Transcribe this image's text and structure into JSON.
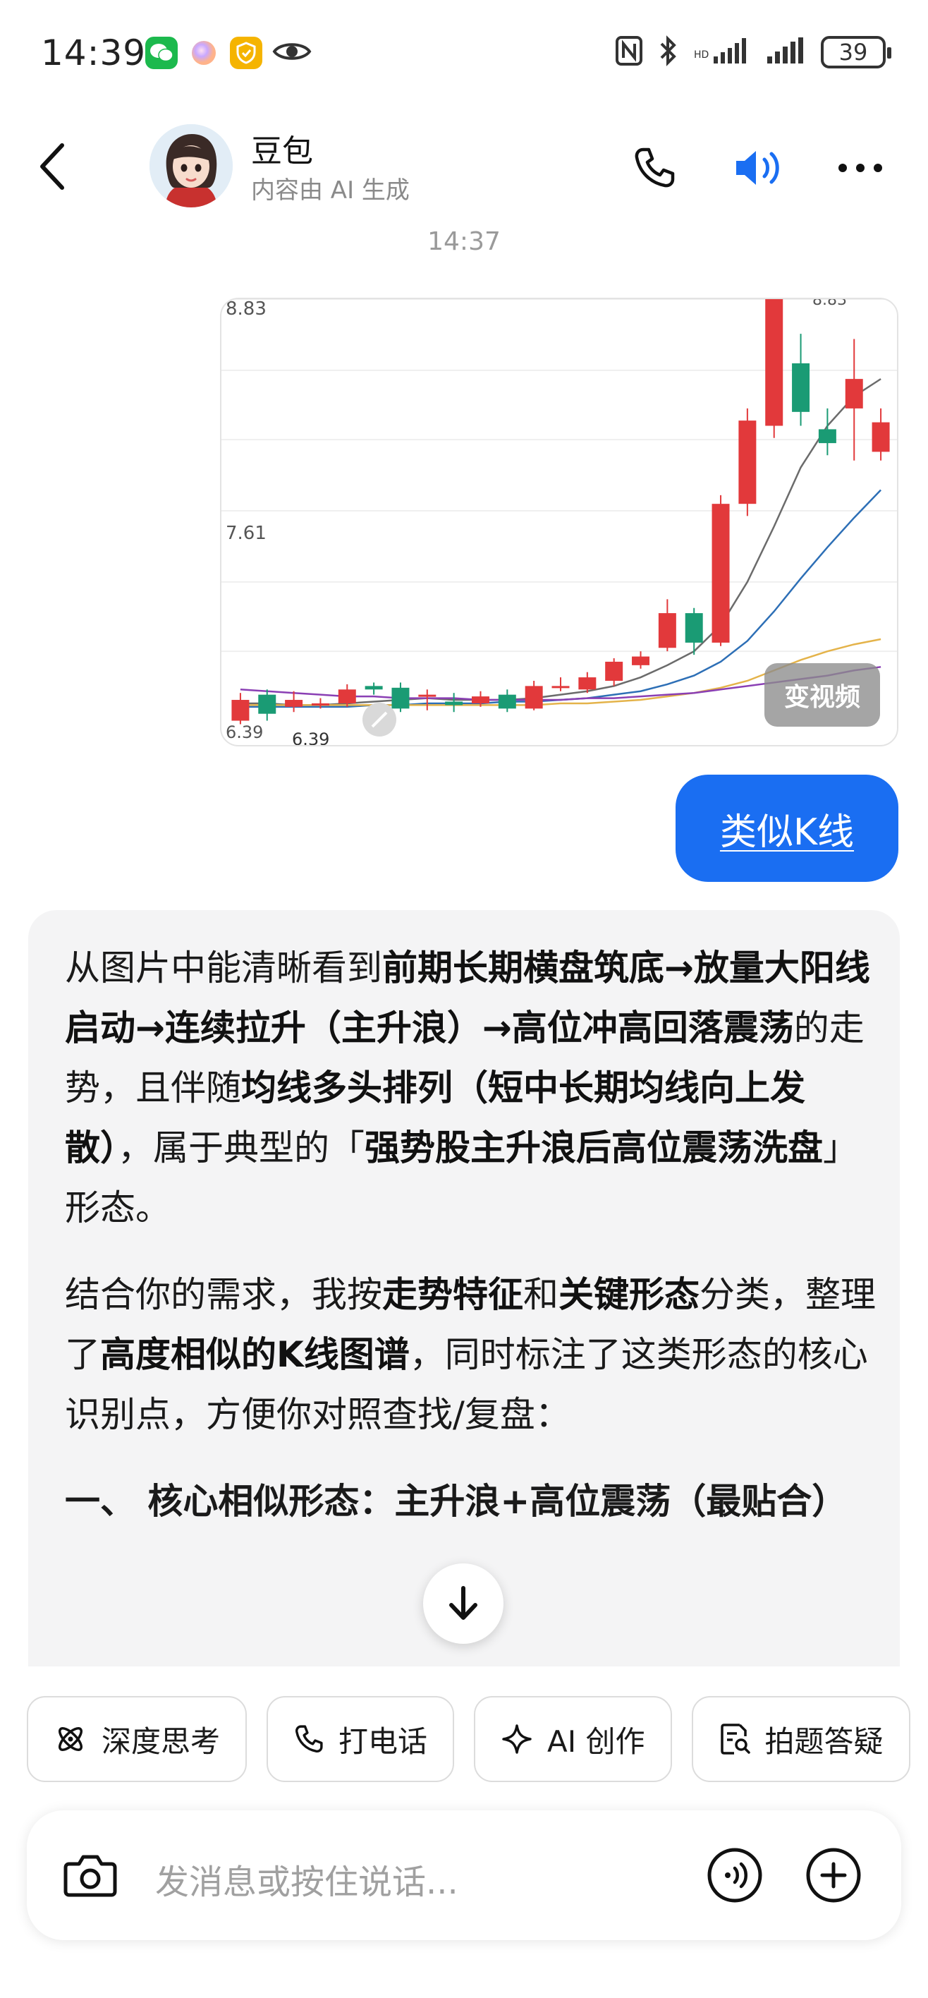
{
  "status_bar": {
    "time": "14:39",
    "battery": "39"
  },
  "header": {
    "name": "豆包",
    "subtitle": "内容由 AI 生成"
  },
  "timestamp": "14:37",
  "chart_card": {
    "top_price_label": "8.83",
    "top_price_label_right": "8.83",
    "mid_price_label": "7.61",
    "low_price_label": "6.39",
    "low_price_label_left": "6.39",
    "video_button": "变视频"
  },
  "chart_data": {
    "type": "candlestick",
    "y_range": [
      6.39,
      8.83
    ],
    "candles": [
      {
        "o": 6.4,
        "c": 6.52,
        "h": 6.56,
        "l": 6.38
      },
      {
        "o": 6.55,
        "c": 6.44,
        "h": 6.58,
        "l": 6.4
      },
      {
        "o": 6.48,
        "c": 6.52,
        "h": 6.57,
        "l": 6.45
      },
      {
        "o": 6.5,
        "c": 6.5,
        "h": 6.53,
        "l": 6.47
      },
      {
        "o": 6.5,
        "c": 6.58,
        "h": 6.61,
        "l": 6.48
      },
      {
        "o": 6.6,
        "c": 6.58,
        "h": 6.62,
        "l": 6.55
      },
      {
        "o": 6.59,
        "c": 6.47,
        "h": 6.62,
        "l": 6.45
      },
      {
        "o": 6.55,
        "c": 6.55,
        "h": 6.58,
        "l": 6.46
      },
      {
        "o": 6.51,
        "c": 6.49,
        "h": 6.56,
        "l": 6.45
      },
      {
        "o": 6.5,
        "c": 6.54,
        "h": 6.57,
        "l": 6.48
      },
      {
        "o": 6.55,
        "c": 6.47,
        "h": 6.58,
        "l": 6.45
      },
      {
        "o": 6.47,
        "c": 6.6,
        "h": 6.63,
        "l": 6.46
      },
      {
        "o": 6.6,
        "c": 6.6,
        "h": 6.65,
        "l": 6.57
      },
      {
        "o": 6.58,
        "c": 6.65,
        "h": 6.68,
        "l": 6.56
      },
      {
        "o": 6.63,
        "c": 6.74,
        "h": 6.76,
        "l": 6.6
      },
      {
        "o": 6.72,
        "c": 6.77,
        "h": 6.8,
        "l": 6.7
      },
      {
        "o": 6.82,
        "c": 7.02,
        "h": 7.1,
        "l": 6.8
      },
      {
        "o": 7.02,
        "c": 6.85,
        "h": 7.05,
        "l": 6.78
      },
      {
        "o": 6.85,
        "c": 7.65,
        "h": 7.7,
        "l": 6.83
      },
      {
        "o": 7.65,
        "c": 8.13,
        "h": 8.2,
        "l": 7.58
      },
      {
        "o": 8.1,
        "c": 8.83,
        "h": 8.83,
        "l": 8.03
      },
      {
        "o": 8.46,
        "c": 8.18,
        "h": 8.63,
        "l": 8.1
      },
      {
        "o": 8.08,
        "c": 8.0,
        "h": 8.2,
        "l": 7.93
      },
      {
        "o": 8.2,
        "c": 8.37,
        "h": 8.6,
        "l": 7.9
      },
      {
        "o": 7.95,
        "c": 8.12,
        "h": 8.2,
        "l": 7.9
      }
    ],
    "ma_lines": [
      {
        "name": "MA5",
        "color": "#6b6b6b",
        "values": [
          6.5,
          6.5,
          6.49,
          6.49,
          6.5,
          6.51,
          6.52,
          6.53,
          6.52,
          6.52,
          6.52,
          6.53,
          6.55,
          6.57,
          6.6,
          6.65,
          6.72,
          6.8,
          6.95,
          7.2,
          7.52,
          7.86,
          8.1,
          8.27,
          8.37
        ]
      },
      {
        "name": "MA10",
        "color": "#2d6fb6",
        "values": [
          6.48,
          6.48,
          6.48,
          6.48,
          6.48,
          6.49,
          6.49,
          6.5,
          6.5,
          6.5,
          6.51,
          6.51,
          6.52,
          6.53,
          6.55,
          6.57,
          6.61,
          6.66,
          6.74,
          6.86,
          7.03,
          7.22,
          7.4,
          7.57,
          7.73
        ]
      },
      {
        "name": "MA20",
        "color": "#e4b34a",
        "values": [
          6.49,
          6.49,
          6.49,
          6.49,
          6.49,
          6.49,
          6.49,
          6.49,
          6.49,
          6.49,
          6.49,
          6.49,
          6.5,
          6.5,
          6.51,
          6.52,
          6.54,
          6.56,
          6.59,
          6.63,
          6.69,
          6.75,
          6.8,
          6.84,
          6.87
        ]
      },
      {
        "name": "MA60",
        "color": "#8a3fb4",
        "values": [
          6.58,
          6.57,
          6.56,
          6.55,
          6.54,
          6.54,
          6.53,
          6.53,
          6.53,
          6.52,
          6.52,
          6.52,
          6.52,
          6.53,
          6.53,
          6.54,
          6.55,
          6.56,
          6.58,
          6.6,
          6.62,
          6.64,
          6.66,
          6.69,
          6.71
        ]
      }
    ]
  },
  "user_message": "类似K线",
  "ai_reply": {
    "p1": [
      {
        "t": "从图片中能清晰看到",
        "b": false
      },
      {
        "t": "前期长期横盘筑底→放量大阳线启动→连续拉升（主升浪）→高位冲高回落震荡",
        "b": true
      },
      {
        "t": "的走势，且伴随",
        "b": false
      },
      {
        "t": "均线多头排列（短中长期均线向上发散）",
        "b": true
      },
      {
        "t": "，属于典型的「",
        "b": false
      },
      {
        "t": "强势股主升浪后高位震荡洗盘",
        "b": true
      },
      {
        "t": "」形态。",
        "b": false
      }
    ],
    "p2": [
      {
        "t": "结合你的需求，我按",
        "b": false
      },
      {
        "t": "走势特征",
        "b": true
      },
      {
        "t": "和",
        "b": false
      },
      {
        "t": "关键形态",
        "b": true
      },
      {
        "t": "分类，整理了",
        "b": false
      },
      {
        "t": "高度相似的K线图谱",
        "b": true
      },
      {
        "t": "，同时标注了这类形态的核心识别点，方便你对照查找/复盘：",
        "b": false
      }
    ],
    "heading": "一、 核心相似形态：主升浪+高位震荡（最贴合）"
  },
  "quick_actions": [
    {
      "label": "深度思考",
      "icon": "atom-icon"
    },
    {
      "label": "打电话",
      "icon": "phone-icon"
    },
    {
      "label": "AI 创作",
      "icon": "sparkle-icon"
    },
    {
      "label": "拍题答疑",
      "icon": "scan-doc-icon"
    }
  ],
  "input": {
    "placeholder": "发消息或按住说话..."
  },
  "colors": {
    "up": "#e2393b",
    "down": "#1a9b74",
    "accent": "#1a6ef2"
  }
}
